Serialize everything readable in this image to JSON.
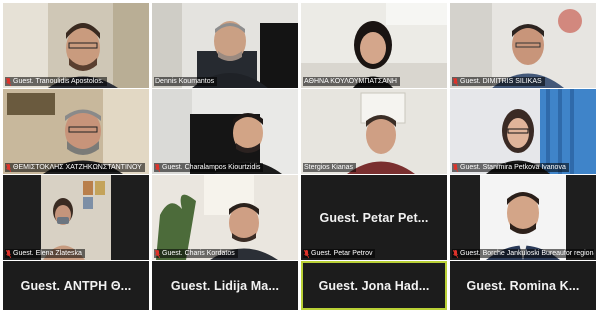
{
  "accent_active_border": "#b9d036",
  "muted_mic_color": "#e0332b",
  "participants": [
    {
      "label": "Guest. Tranoulidis Apostolos.",
      "muted": true
    },
    {
      "label": "Dennis Koumantos",
      "muted": false
    },
    {
      "label": "ΑΘΗΝΑ ΚΟΥΛΟΥΜΠΑΤΣΑΝΗ",
      "muted": false
    },
    {
      "label": "Guest. DIMITRIS SILIKAS",
      "muted": true
    },
    {
      "label": "ΘΕΜΙΣΤΟΚΛΗΣ ΧΑΤΖΗΚΩΝΣΤΑΝΤΙΝΟΥ",
      "muted": true
    },
    {
      "label": "Guest. Charalampos Kiourtzidis",
      "muted": true
    },
    {
      "label": "Stergios Kianas",
      "muted": false
    },
    {
      "label": "Guest. Stanimira Petkova Ivanova",
      "muted": true
    },
    {
      "label": "Guest. Elena Zlateska",
      "muted": true
    },
    {
      "label": "Guest. Charis Kordatos",
      "muted": true
    },
    {
      "name": "Guest. Petar Pet...",
      "label": "Guest. Petar Petrov",
      "muted": true
    },
    {
      "label": "Guest. Borche Jankuloski Bureaufor regional de",
      "muted": true
    },
    {
      "name": "Guest. ΑΝΤΡΗ Θ..."
    },
    {
      "name": "Guest. Lidija Ma..."
    },
    {
      "name": "Guest. Jona Had...",
      "active": true
    },
    {
      "name": "Guest. Romina K..."
    }
  ]
}
